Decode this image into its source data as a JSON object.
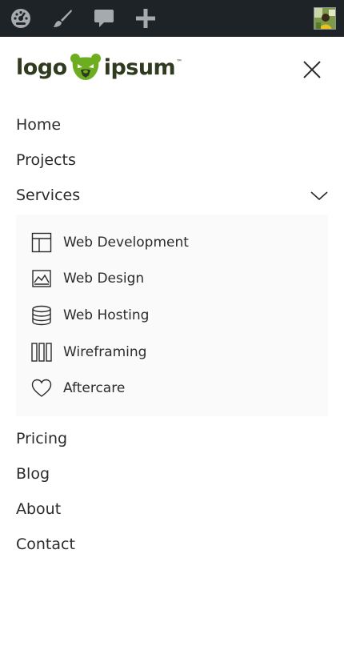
{
  "admin_bar": {
    "icons": [
      "dashboard-icon",
      "brush-icon",
      "comment-icon",
      "plus-icon"
    ],
    "avatar": "user-avatar"
  },
  "header": {
    "logo_left": "logo",
    "logo_right": "ipsum",
    "logo_tm": "™",
    "logo_color": "#2f3a1f",
    "logo_mark_color": "#6cae1f",
    "close_icon": "close-icon"
  },
  "nav": {
    "items_top": [
      {
        "label": "Home"
      },
      {
        "label": "Projects"
      },
      {
        "label": "Services",
        "expanded": true
      }
    ],
    "services_submenu": [
      {
        "label": "Web Development",
        "icon": "layout-icon"
      },
      {
        "label": "Web Design",
        "icon": "image-icon"
      },
      {
        "label": "Web Hosting",
        "icon": "database-icon"
      },
      {
        "label": "Wireframing",
        "icon": "columns-icon"
      },
      {
        "label": "Aftercare",
        "icon": "heart-icon"
      }
    ],
    "items_bottom": [
      {
        "label": "Pricing"
      },
      {
        "label": "Blog"
      },
      {
        "label": "About"
      },
      {
        "label": "Contact"
      }
    ]
  }
}
